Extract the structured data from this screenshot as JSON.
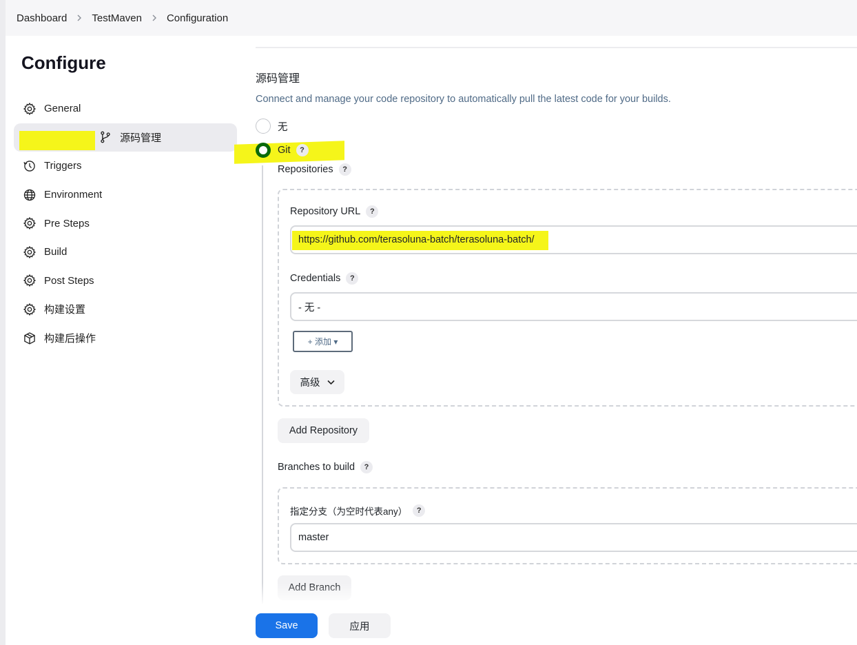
{
  "breadcrumb": {
    "items": [
      "Dashboard",
      "TestMaven",
      "Configuration"
    ],
    "separator": ">"
  },
  "sidebar": {
    "title": "Configure",
    "items": [
      {
        "label": "General",
        "icon": "gear-icon"
      },
      {
        "label": "源码管理",
        "icon": "git-branch-icon",
        "active": true
      },
      {
        "label": "Triggers",
        "icon": "clock-icon"
      },
      {
        "label": "Environment",
        "icon": "globe-icon"
      },
      {
        "label": "Pre Steps",
        "icon": "gear-icon"
      },
      {
        "label": "Build",
        "icon": "gear-icon"
      },
      {
        "label": "Post Steps",
        "icon": "gear-icon"
      },
      {
        "label": "构建设置",
        "icon": "gear-icon"
      },
      {
        "label": "构建后操作",
        "icon": "package-icon"
      }
    ]
  },
  "scm": {
    "title": "源码管理",
    "description": "Connect and manage your code repository to automatically pull the latest code for your builds.",
    "option_none": "无",
    "option_git": "Git",
    "selected": "Git",
    "help_glyph": "?",
    "repositories_label": "Repositories",
    "repository_url_label": "Repository URL",
    "repository_url_value": "https://github.com/terasoluna-batch/terasoluna-batch/",
    "credentials_label": "Credentials",
    "credentials_value": "- 无 -",
    "add_button": "+ 添加 ▾",
    "advanced_button": "高级",
    "add_repository_button": "Add Repository",
    "branches_label": "Branches to build",
    "branch_specifier_label": "指定分支（为空时代表any）",
    "branch_value": "master",
    "add_branch_button": "Add Branch"
  },
  "footer": {
    "save_label": "Save",
    "apply_label": "应用"
  },
  "colors": {
    "accent": "#1a73e8",
    "highlight": "#f5f51a",
    "radio_checked": "#0a6a0a",
    "description": "#4f6a86"
  }
}
